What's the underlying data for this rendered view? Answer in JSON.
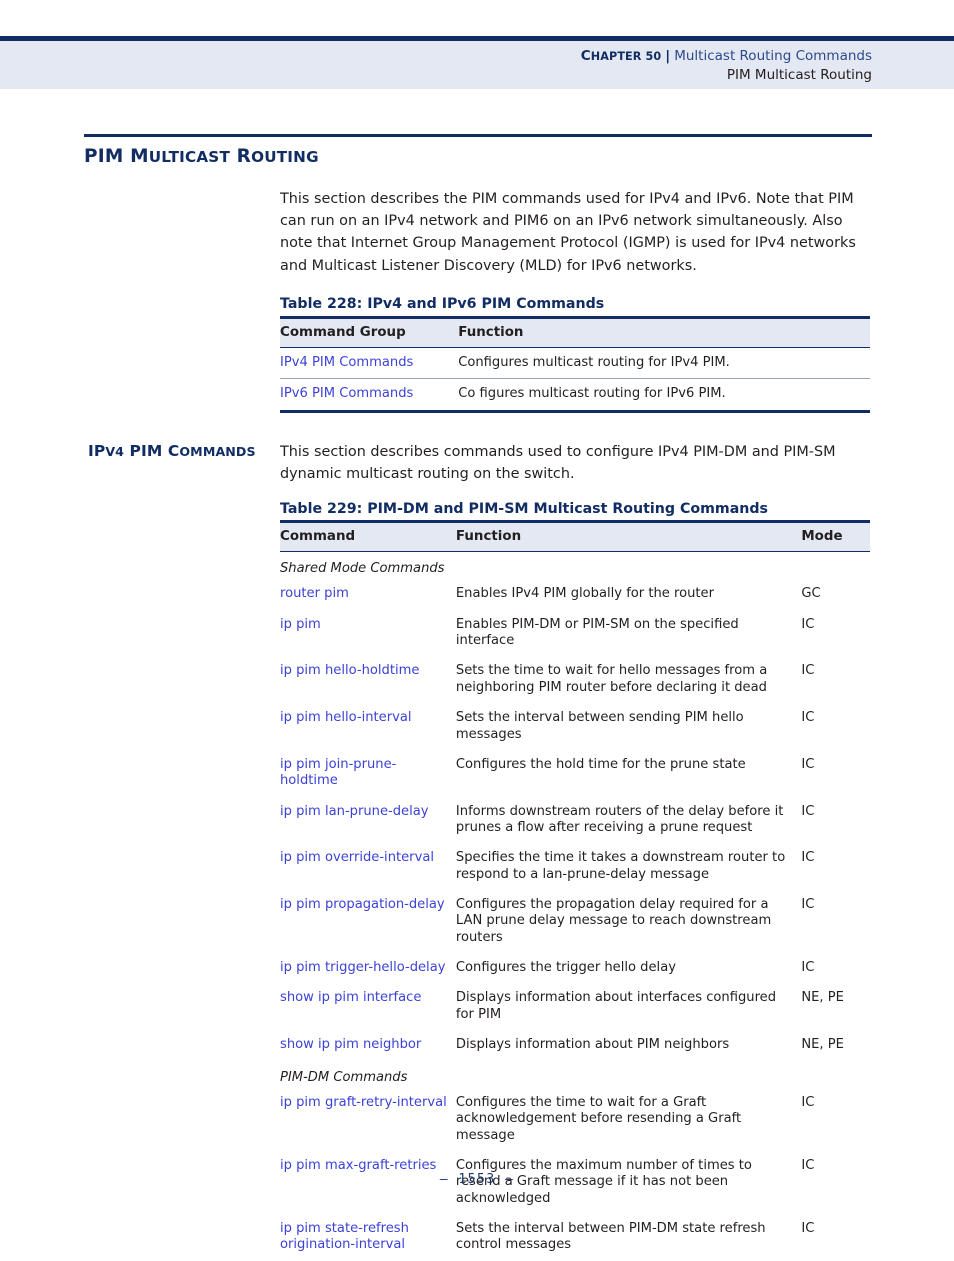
{
  "header": {
    "chapter_label": "CHAPTER 50",
    "chapter_label_first": "C",
    "chapter_label_rest": "HAPTER 50",
    "separator": "|",
    "chapter_title": "Multicast Routing Commands",
    "subtitle": "PIM Multicast Routing"
  },
  "section": {
    "heading_parts": [
      "PIM M",
      "ULTICAST",
      " R",
      "OUTING"
    ],
    "heading_full": "PIM Multicast Routing",
    "intro_paragraph": "This section describes the PIM commands used for IPv4 and IPv6. Note that PIM can run on an IPv4 network and PIM6 on an IPv6 network simultaneously. Also note that Internet Group Management Protocol (IGMP) is used for IPv4 networks and Multicast Listener Discovery (MLD) for IPv6 networks."
  },
  "table228": {
    "caption": "Table 228: IPv4 and IPv6 PIM Commands",
    "columns": [
      "Command Group",
      "Function"
    ],
    "rows": [
      {
        "command": "IPv4 PIM Commands",
        "function": "Configures multicast routing for IPv4 PIM."
      },
      {
        "command": "IPv6 PIM Commands",
        "function": "Co figures multicast routing for IPv6 PIM."
      }
    ]
  },
  "ipv4_section": {
    "side_heading_full": "IPv4 PIM Commands",
    "side_heading_parts": [
      "IP",
      "V4",
      " PIM C",
      "OMMANDS"
    ],
    "paragraph": "This section describes commands used to configure IPv4 PIM-DM and PIM-SM dynamic multicast routing on the switch."
  },
  "table229": {
    "caption": "Table 229: PIM-DM and PIM-SM Multicast Routing Commands",
    "columns": [
      "Command",
      "Function",
      "Mode"
    ],
    "rows": [
      {
        "type": "group",
        "label": "Shared Mode Commands"
      },
      {
        "type": "cmd",
        "command": "router pim",
        "function": "Enables IPv4 PIM globally for the router",
        "mode": "GC"
      },
      {
        "type": "cmd",
        "command": "ip pim",
        "function": "Enables PIM-DM or PIM-SM on the specified interface",
        "mode": "IC"
      },
      {
        "type": "cmd",
        "command": "ip pim hello-holdtime",
        "function": "Sets the time to wait for hello messages from a neighboring PIM router before declaring it dead",
        "mode": "IC"
      },
      {
        "type": "cmd",
        "command": "ip pim hello-interval",
        "function": "Sets the interval between sending PIM hello messages",
        "mode": "IC"
      },
      {
        "type": "cmd",
        "command": "ip pim join-prune-holdtime",
        "function": "Configures the hold time for the prune state",
        "mode": "IC"
      },
      {
        "type": "cmd",
        "command": "ip pim lan-prune-delay",
        "function": "Informs downstream routers of the delay before it prunes a flow after receiving a prune request",
        "mode": "IC"
      },
      {
        "type": "cmd",
        "command": "ip pim override-interval",
        "function": "Specifies the time it takes a downstream router to respond to a lan-prune-delay message",
        "mode": "IC"
      },
      {
        "type": "cmd",
        "command": "ip pim propagation-delay",
        "function": "Configures the propagation delay required for a LAN prune delay message to reach downstream routers",
        "mode": "IC"
      },
      {
        "type": "cmd",
        "command": "ip pim trigger-hello-delay",
        "function": "Configures the trigger hello delay",
        "mode": "IC"
      },
      {
        "type": "cmd",
        "command": "show ip pim interface",
        "function": "Displays information about interfaces configured for PIM",
        "mode": "NE, PE"
      },
      {
        "type": "cmd",
        "command": "show ip pim neighbor",
        "function": "Displays information about PIM neighbors",
        "mode": "NE, PE"
      },
      {
        "type": "group",
        "label": "PIM-DM Commands"
      },
      {
        "type": "cmd",
        "command": "ip pim graft-retry-interval",
        "function": "Configures the time to wait for a Graft acknowledgement before resending a Graft message",
        "mode": "IC"
      },
      {
        "type": "cmd",
        "command": "ip pim max-graft-retries",
        "function": "Configures the maximum number of times to resend a Graft message if it has not been acknowledged",
        "mode": "IC"
      },
      {
        "type": "cmd",
        "command": "ip pim state-refresh origination-interval",
        "function": "Sets the interval between PIM-DM state refresh control messages",
        "mode": "IC"
      }
    ]
  },
  "footer": {
    "page_number": "–  1553  –"
  },
  "colors": {
    "navy": "#112d63",
    "header_band": "#e4e8f2",
    "link": "#3c42d6",
    "body_text": "#231f20",
    "chapter_title": "#2b4a8b"
  }
}
